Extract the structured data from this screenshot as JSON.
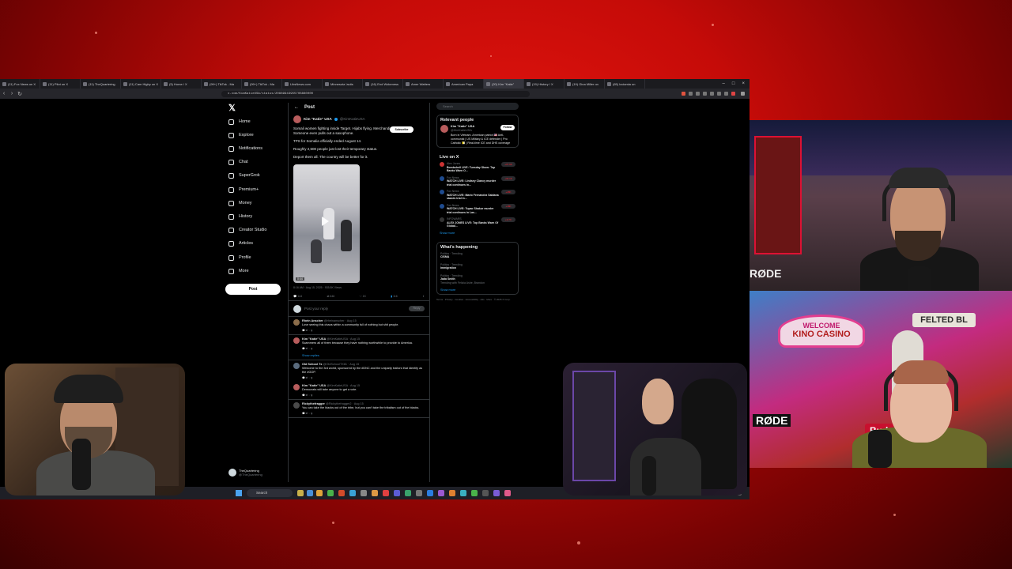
{
  "browser": {
    "tabs": [
      {
        "label": "(11) Fox News on X"
      },
      {
        "label": "(11) Pilot on X"
      },
      {
        "label": "(11) TheQuartering"
      },
      {
        "label": "(11) Cam Higby on X"
      },
      {
        "label": "(5) Home / X"
      },
      {
        "label": "(99+) TikTok - Ma"
      },
      {
        "label": "(99+) TikTok - Ma"
      },
      {
        "label": "LibsNews.com"
      },
      {
        "label": "Minnesota 'autis"
      },
      {
        "label": "(16) End Wokeness"
      },
      {
        "label": "Amer Watters"
      },
      {
        "label": "American Papa"
      },
      {
        "label": "(20) Kim \"Katie\"",
        "active": true
      },
      {
        "label": "(19) History / X"
      },
      {
        "label": "(19) Gina Miller on"
      },
      {
        "label": "(65) lociamia on"
      }
    ],
    "url": "x.com/KimKatieUSA/status/20889943955708880000"
  },
  "x": {
    "nav": [
      {
        "label": "Home",
        "icon": "home-icon"
      },
      {
        "label": "Explore",
        "icon": "search-icon"
      },
      {
        "label": "Notifications",
        "icon": "bell-icon"
      },
      {
        "label": "Chat",
        "icon": "chat-icon"
      },
      {
        "label": "SuperGrok",
        "icon": "grok-icon"
      },
      {
        "label": "Premium+",
        "icon": "premium-icon"
      },
      {
        "label": "Money",
        "icon": "money-icon"
      },
      {
        "label": "History",
        "icon": "history-icon"
      },
      {
        "label": "Creator Studio",
        "icon": "studio-icon"
      },
      {
        "label": "Articles",
        "icon": "articles-icon"
      },
      {
        "label": "Profile",
        "icon": "profile-icon"
      },
      {
        "label": "More",
        "icon": "more-icon"
      }
    ],
    "post_button": "Post",
    "account": {
      "name": "TheQuartering",
      "handle": "@TheQuartering"
    },
    "timeline": {
      "header": "Post",
      "author_name": "Kim \"Katie\" USA",
      "author_handle": "@KimKatieUSA",
      "subscribe_label": "Subscribe",
      "paragraphs": [
        "Somali women fighting inside Target. Hijabs flying. Merchandise everywhere. Someone even pulls out a saxophone.",
        "TPS for Somalia officially ended August 14.",
        "Roughly 2,500 people just lost their temporary status.",
        "Deport them all. The country will be better for it."
      ],
      "video_time": "0:44",
      "meta": "8:16 AM · Aug 15, 2025 · 935.8K Views",
      "actions": [
        "144",
        "646",
        "1K",
        "116"
      ],
      "reply_placeholder": "Post your reply",
      "reply_button": "Reply",
      "replies": [
        {
          "name": "Rhein Anscher",
          "handle": "@rheinanscher · Aug 15",
          "text": "Love seeing this chaos within a community full of nothing but shit people."
        },
        {
          "name": "Kim \"Katie\" USA",
          "handle": "@KimKatieUSA · Aug 15",
          "text": "Scammers all of them because they have nothing worthwhile to provide to America."
        },
        {
          "name": "Old School Tx",
          "handle": "@OldSchoolTX81 · Aug 15",
          "text": "Welcome to the 3rd world, sponsored by the #DNC and the uniparty traitors that identify as the #GOP."
        },
        {
          "name": "Kim \"Katie\" USA",
          "handle": "@KimKatieUSA · Aug 15",
          "text": "Democrats will take anyone to get a vote."
        },
        {
          "name": "Rickythefragger",
          "handle": "@Rickythefragger2 · Aug 15",
          "text": "You can take the blacks out of the tribe, but you can't take the tribalism out of the blacks."
        }
      ],
      "show_replies": "Show replies"
    },
    "right": {
      "search_placeholder": "Search",
      "relevant_title": "Relevant people",
      "relevant_name": "Kim \"Katie\" USA",
      "relevant_handle": "@KimKatieUSA",
      "follow_label": "Follow",
      "relevant_bio": "Born in Vietnam. American patriot 🇺🇸 Anti-communist | US Military & ICE defender | Pro Catholic 🇻🇦 | Real-time ICE and DHS coverage",
      "live_title": "Live on X",
      "live": [
        {
          "host": "Alex Jones",
          "title": "Bombshell LIVE: Tuesday Show: Top Banks Warn O...",
          "count": "+37.9K"
        },
        {
          "host": "Fox News",
          "title": "WATCH LIVE: Lindsey Clancy murder trial continues in...",
          "count": "+32.1K"
        },
        {
          "host": "Fox News",
          "title": "WATCH LIVE: Mario Fernandez Saldana stands trial in...",
          "count": "+28K"
        },
        {
          "host": "Fox News",
          "title": "WATCH LIVE: Tupac Shakur murder trial continues in Las...",
          "count": "+18K"
        },
        {
          "host": "INFOWARS",
          "title": "ALEX JONES LIVE: Top Banks Warn Of Global...",
          "count": "+9.7K"
        }
      ],
      "show_more": "Show more",
      "happening_title": "What's happening",
      "trends": [
        {
          "category": "Politics · Trending",
          "name": "CISMA"
        },
        {
          "category": "Politics · Trending",
          "name": "Immigration"
        },
        {
          "category": "Politics · Trending",
          "name": "Jada Smith"
        }
      ],
      "trend_note": "Trending with Felicia Ashe, Brandon",
      "footer": "Terms · Privacy · Cookies · Accessibility · Ads · More · © 2025 X Corp."
    }
  },
  "taskbar": {
    "search_placeholder": "Search"
  },
  "overlay": {
    "mic_brand_1": "RØDE",
    "mic_brand_2": "RØDE",
    "sign_welcome": "WELCOME",
    "sign_casino": "KINO CASINO",
    "sign_felted": "FELTED BL",
    "sign_budweiser": "Budweiser"
  },
  "colors": {
    "background": "#c50b08",
    "x_blue": "#1d9bf0"
  }
}
